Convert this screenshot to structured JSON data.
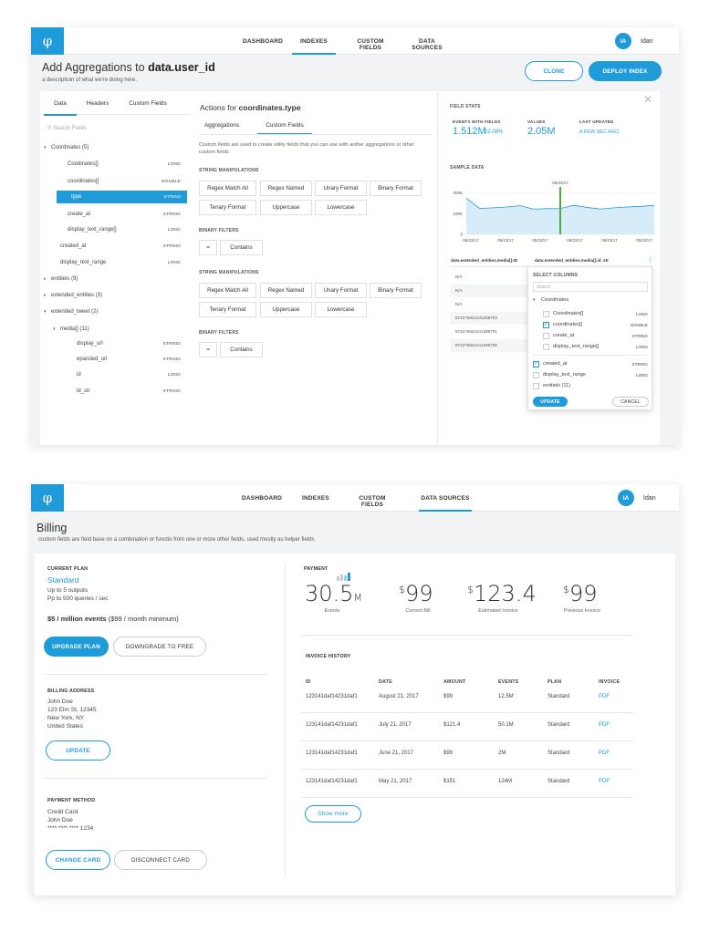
{
  "screen1": {
    "nav": [
      "DASHBOARD",
      "INDEXES",
      "CUSTOM FIELDS",
      "DATA SOURCES"
    ],
    "active_nav": "INDEXES",
    "user": {
      "initials": "IA",
      "name": "Idan"
    },
    "title_prefix": "Add Aggregations to ",
    "title_bold": "data.user_id",
    "subtitle": "a descriptioin of what we're doing here.",
    "clone_label": "CLONE",
    "deploy_label": "DEPLOY INDEX",
    "left_tabs": [
      "Data",
      "Headers",
      "Custom Fields"
    ],
    "search_placeholder": "Search Fields",
    "tree": [
      {
        "label": "Coordinates (5)",
        "type": "",
        "caret": "▾"
      },
      {
        "label": "Coodinates[]",
        "type": "LONG",
        "caret": ""
      },
      {
        "label": "coordinates[]",
        "type": "DOUBLE",
        "caret": ""
      },
      {
        "label": "type",
        "type": "STRING",
        "caret": ""
      },
      {
        "label": "create_at",
        "type": "STRING",
        "caret": ""
      },
      {
        "label": "display_text_range[]",
        "type": "LONG",
        "caret": ""
      },
      {
        "label": "created_at",
        "type": "STRING",
        "caret": ""
      },
      {
        "label": "display_text_range",
        "type": "LONG",
        "caret": ""
      },
      {
        "label": "entitiels (9)",
        "type": "",
        "caret": "▸"
      },
      {
        "label": "extended_entities (3)",
        "type": "",
        "caret": "▸"
      },
      {
        "label": "extended_tweet (2)",
        "type": "",
        "caret": "▾"
      },
      {
        "label": "media[] (11)",
        "type": "",
        "caret": "▾"
      },
      {
        "label": "display_url",
        "type": "STRING",
        "caret": ""
      },
      {
        "label": "epanded_url",
        "type": "STRING",
        "caret": ""
      },
      {
        "label": "id",
        "type": "LONG",
        "caret": ""
      },
      {
        "label": "id_str",
        "type": "STRING",
        "caret": ""
      }
    ],
    "actions_prefix": "Actions for ",
    "actions_field": "coordinates.type",
    "action_tabs": [
      "Aggregations",
      "Custom Fields"
    ],
    "action_desc": "Custom fields are used to create utility fields that you can use with aother aggregations or other custom fields",
    "string_manip_label": "STRING MANIPULATIONS",
    "binary_filters_label": "BINARY FILTERS",
    "chips_row1": [
      "Regex Match All",
      "Regex Named",
      "Unary Format",
      "Binary Format"
    ],
    "chips_row2": [
      "Tenary Format",
      "Uppercase",
      "Lowercase"
    ],
    "chips_binary": [
      "=",
      "Contains"
    ],
    "field_stats_label": "FIELD STATS",
    "stats": [
      {
        "head": "EVENTS WITH FIELDS",
        "value": "1.512M",
        "sub": "22.08%"
      },
      {
        "head": "VALUES",
        "value": "2.05M",
        "sub": ""
      },
      {
        "head": "LAST UPDATED",
        "value": "",
        "sub": "A FEW SEC AGO"
      }
    ],
    "sample_data_label": "SAMPLE DATA",
    "chart_data": {
      "type": "area",
      "x": [
        "05/23/17",
        "05/23/17",
        "05/23/17",
        "05/23/17",
        "05/23/17",
        "05/23/17"
      ],
      "values": [
        175,
        125,
        128,
        132,
        138,
        122,
        124,
        125,
        140,
        130,
        122,
        128,
        132,
        135,
        140
      ],
      "ytick_labels": [
        "200K",
        "100K",
        "0"
      ],
      "highlight_label": "05/23/17",
      "ylim": [
        0,
        220000
      ]
    },
    "col_headers": [
      "data.extended_entities.media[].ID",
      "data.extended_entities.media[].id_str"
    ],
    "col_values": [
      "N/A",
      "N/A",
      "N/A",
      "872275841241288703",
      "872275841241288701",
      "872275841241288700"
    ],
    "select_columns": {
      "title": "SELECT COLUMNS",
      "search_placeholder": "search...",
      "items": [
        {
          "label": "Coordinates",
          "type": "",
          "checked": false,
          "group": true
        },
        {
          "label": "Coordinates[]",
          "type": "LONG",
          "checked": false,
          "group": false
        },
        {
          "label": "coordinates[]",
          "type": "DOUBLE",
          "checked": true,
          "group": false
        },
        {
          "label": "create_at",
          "type": "STRING",
          "checked": false,
          "group": false
        },
        {
          "label": "display_text_range[]",
          "type": "LONG",
          "checked": false,
          "group": false
        },
        {
          "label": "created_at",
          "type": "STRING",
          "checked": true,
          "group": false
        },
        {
          "label": "display_text_range",
          "type": "LONG",
          "checked": false,
          "group": false
        },
        {
          "label": "entitiels (11)",
          "type": "",
          "checked": false,
          "group": false
        }
      ],
      "update_label": "UPDATE",
      "cancel_label": "CANCEL"
    }
  },
  "screen2": {
    "nav": [
      "DASHBOARD",
      "INDEXES",
      "CUSTOM FIELDS",
      "DATA SOURCES"
    ],
    "active_nav": "DATA SOURCES",
    "user": {
      "initials": "IA",
      "name": "Idan"
    },
    "title": "Billing",
    "subtitle": "custom fields are field base on a combination or functio from one or more other fields, used mostly as helper fields",
    "current_plan_label": "CURRENT PLAN",
    "plan_name": "Standard",
    "plan_line1": "Up to 5 outputs",
    "plan_line2": "Pp to 500 queries / sec",
    "price_bold": "$5 / million events",
    "price_rest": " ($99 / month minimum)",
    "upgrade_label": "UPGRADE PLAN",
    "downgrade_label": "DOWNGRADE TO FREE",
    "billing_address_label": "BILLING ADDRESS",
    "address": [
      "John Doe",
      "123 Elm St, 12345",
      "New York, NY",
      "United States"
    ],
    "update_label": "UPDATE",
    "payment_method_label": "PAYMENT METHOD",
    "payment": [
      "Credit Card",
      "John Doe",
      "**** **** **** 1234"
    ],
    "change_card_label": "CHANGE CARD",
    "disconnect_label": "DISCONNECT CARD",
    "payment_label": "PAYMENT",
    "metrics": [
      {
        "cur": "",
        "value": "30.5",
        "unit": "M",
        "caption": "Events"
      },
      {
        "cur": "$",
        "value": "99",
        "unit": "",
        "caption": "Current Bill"
      },
      {
        "cur": "$",
        "value": "123.4",
        "unit": "",
        "caption": "Estimated Invoice"
      },
      {
        "cur": "$",
        "value": "99",
        "unit": "",
        "caption": "Previous Invoice"
      }
    ],
    "invoice_history_label": "INVOICE HISTORY",
    "invoice_headers": [
      "ID",
      "DATE",
      "AMOUNT",
      "EVENTS",
      "PLAN",
      "INVOICE"
    ],
    "invoices": [
      [
        "123141daf14231daf1",
        "August 21, 2017",
        "$99",
        "12.5M",
        "Standard",
        "PDF"
      ],
      [
        "123141daf14231daf1",
        "July 21, 2017",
        "$121.4",
        "50.1M",
        "Standard",
        "PDF"
      ],
      [
        "123141daf14231daf1",
        "June 21, 2017",
        "$99",
        "2M",
        "Standard",
        "PDF"
      ],
      [
        "123141daf14231daf1",
        "May 21, 2017",
        "$151",
        "124M",
        "Standard",
        "PDF"
      ]
    ],
    "show_more_label": "Show more"
  },
  "colors": {
    "accent": "#1e9bd8",
    "background": "#f2f3f5"
  }
}
